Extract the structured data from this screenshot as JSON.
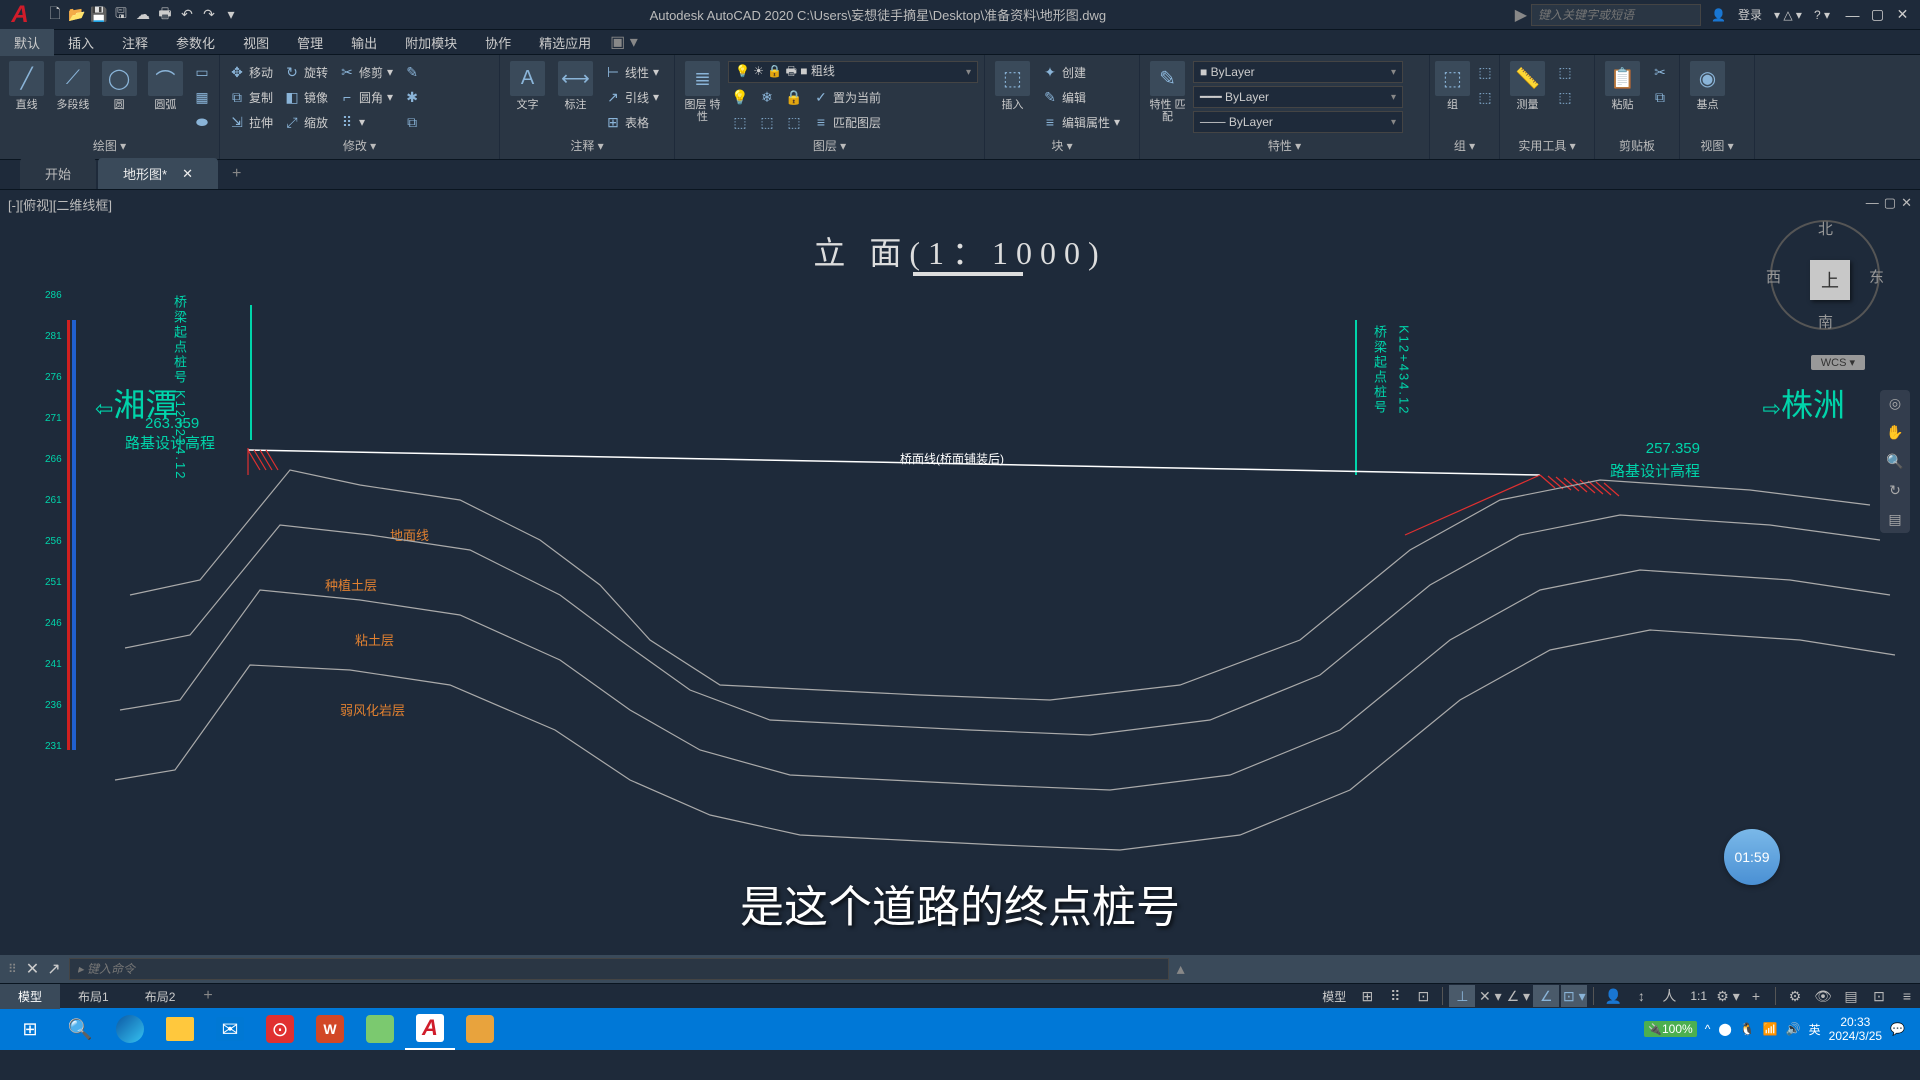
{
  "titlebar": {
    "app_title": "Autodesk AutoCAD 2020    C:\\Users\\妄想徒手摘星\\Desktop\\准备资料\\地形图.dwg",
    "search_placeholder": "键入关键字或短语",
    "login_label": "登录"
  },
  "menu": {
    "tabs": [
      "默认",
      "插入",
      "注释",
      "参数化",
      "视图",
      "管理",
      "输出",
      "附加模块",
      "协作",
      "精选应用"
    ]
  },
  "ribbon": {
    "panels": {
      "draw": {
        "title": "绘图 ▾",
        "line": "直线",
        "polyline": "多段线",
        "circle": "圆",
        "arc": "圆弧"
      },
      "modify": {
        "title": "修改 ▾",
        "move": "移动",
        "rotate": "旋转",
        "trim": "修剪",
        "copy": "复制",
        "mirror": "镜像",
        "fillet": "圆角",
        "stretch": "拉伸",
        "scale": "缩放"
      },
      "annotate": {
        "title": "注释 ▾",
        "text": "文字",
        "dim": "标注",
        "linear": "线性",
        "leader": "引线",
        "table": "表格"
      },
      "layer": {
        "title": "图层 ▾",
        "props": "图层\n特性",
        "current_layer": "粗线",
        "make_current": "置为当前",
        "match": "匹配图层"
      },
      "block": {
        "title": "块 ▾",
        "insert": "插入",
        "create": "创建",
        "edit": "编辑",
        "edit_attr": "编辑属性"
      },
      "properties": {
        "title": "特性 ▾",
        "match": "特性\n匹配",
        "layer_val": "ByLayer",
        "ltype_val": "ByLayer",
        "lweight_val": "ByLayer"
      },
      "group": {
        "title": "组 ▾",
        "group": "组"
      },
      "utilities": {
        "title": "实用工具 ▾",
        "measure": "测量"
      },
      "clipboard": {
        "title": "剪贴板",
        "paste": "粘贴"
      },
      "view": {
        "title": "视图 ▾",
        "base": "基点"
      }
    }
  },
  "file_tabs": {
    "start": "开始",
    "current": "地形图*"
  },
  "viewport": {
    "label": "[-][俯视][二维线框]"
  },
  "drawing": {
    "title": "立 面(1：1000)",
    "axis_ticks": [
      "286",
      "281",
      "276",
      "271",
      "266",
      "261",
      "256",
      "251",
      "246",
      "241",
      "236",
      "231"
    ],
    "left_city": "湘潭",
    "right_city": "株洲",
    "left_elev": "263.359",
    "right_elev": "257.359",
    "left_station": "K12+234.12",
    "right_station": "K12+434.12",
    "left_bridge_label": "桥梁起点桩号",
    "right_bridge_label": "桥梁起点桩号",
    "road_design_label": "路基设计高程",
    "bridge_surface_label": "桥面线(桥面铺装后)",
    "terrain_labels": {
      "ground": "地面线",
      "topsoil": "种植土层",
      "clay": "粘土层",
      "weathered": "弱风化岩层"
    }
  },
  "nav_cube": {
    "n": "北",
    "s": "南",
    "e": "东",
    "w": "西",
    "top": "上",
    "wcs": "WCS ▾"
  },
  "subtitle": "是这个道路的终点桩号",
  "timer": "01:59",
  "cmdline": {
    "placeholder": "▸ 键入命令"
  },
  "layout_tabs": [
    "模型",
    "布局1",
    "布局2"
  ],
  "statusbar": {
    "model": "模型",
    "scale": "1:1"
  },
  "taskbar": {
    "battery": "100%",
    "ime": "英",
    "time": "20:33",
    "date": "2024/3/25"
  }
}
